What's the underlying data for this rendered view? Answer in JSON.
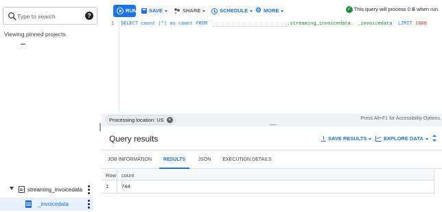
{
  "explorer": {
    "search_placeholder": "Type to search",
    "help_glyph": "?",
    "pinned_text": "Viewing pinned projects.",
    "dataset_label": "streaming_invoicedata",
    "table_label": "_invoicedata"
  },
  "toolbar": {
    "run_label": "RUN",
    "save_label": "SAVE",
    "share_label": "SHARE",
    "schedule_label": "SCHEDULE",
    "more_label": "MORE",
    "status_text": "This query will process 0 B when run."
  },
  "editor": {
    "line_number": "1",
    "query_prefix": "SELECT count (*) as count FROM `",
    "query_table": ".streaming_invoicedata.",
    "query_table_tail": "_invoicedata`",
    "query_limit_kw": " LIMIT ",
    "query_limit_value": "1000"
  },
  "location_bar": {
    "chip_label": "Processing location: US",
    "chip_close": "×",
    "accessibility_hint": "Press Alt+F1 for Accessibility Options."
  },
  "results": {
    "title": "Query results",
    "save_results_label": "SAVE RESULTS",
    "explore_data_label": "EXPLORE DATA",
    "tabs": [
      "JOB INFORMATION",
      "RESULTS",
      "JSON",
      "EXECUTION DETAILS"
    ],
    "active_tab": "RESULTS",
    "columns": [
      "Row",
      "count"
    ],
    "rows": [
      [
        "1",
        "744"
      ]
    ]
  },
  "colors": {
    "accent": "#1a73e8",
    "success": "#1e8e3e",
    "selected_row_bg": "#e8f0fe"
  },
  "icons": [
    "search-icon",
    "help-icon",
    "dataset-icon",
    "table-icon",
    "kebab-icon",
    "play-icon",
    "save-icon",
    "share-icon",
    "schedule-icon",
    "gear-icon",
    "check-circle-icon",
    "close-icon",
    "download-icon",
    "chart-icon",
    "expand-icon"
  ]
}
